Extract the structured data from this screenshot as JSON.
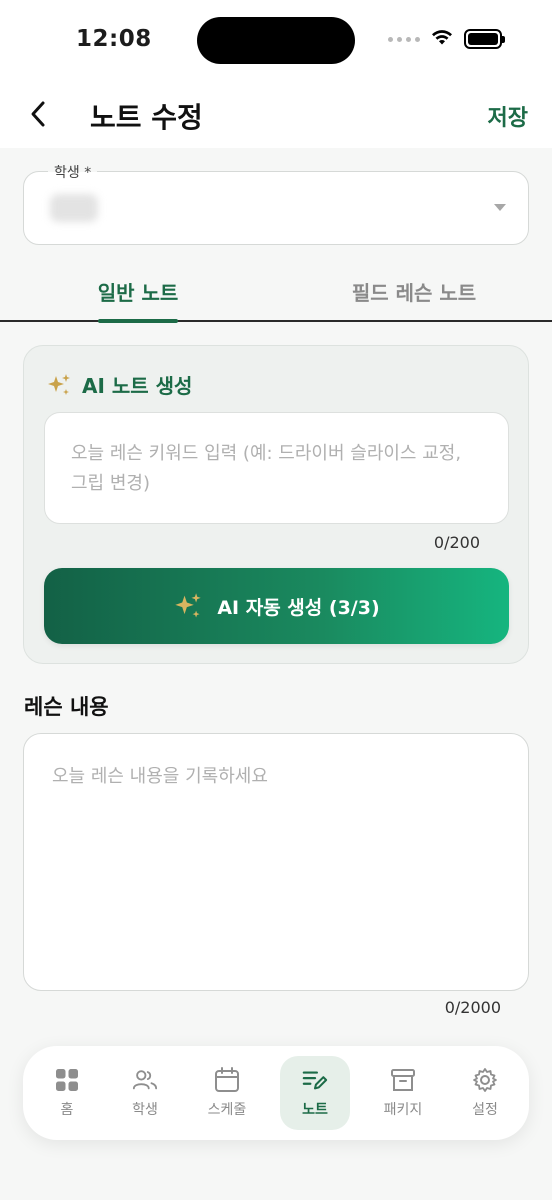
{
  "status_bar": {
    "time": "12:08"
  },
  "header": {
    "title": "노트 수정",
    "save_label": "저장",
    "back_icon": "chevron-left-icon"
  },
  "student_field": {
    "label": "학생 *",
    "selected_value": ""
  },
  "tabs": [
    {
      "label": "일반 노트",
      "active": true
    },
    {
      "label": "필드 레슨 노트",
      "active": false
    }
  ],
  "ai_card": {
    "title": "AI 노트 생성",
    "keyword_placeholder": "오늘 레슨 키워드 입력 (예: 드라이버 슬라이스 교정, 그립 변경)",
    "keyword_value": "",
    "keyword_counter": "0/200",
    "generate_button_label": "AI 자동 생성 (3/3)"
  },
  "lesson": {
    "section_title": "레슨 내용",
    "placeholder": "오늘 레슨 내용을 기록하세요",
    "value": "",
    "counter": "0/2000"
  },
  "bottom_nav": [
    {
      "label": "홈",
      "icon": "grid-icon",
      "active": false
    },
    {
      "label": "학생",
      "icon": "people-icon",
      "active": false
    },
    {
      "label": "스케줄",
      "icon": "calendar-icon",
      "active": false
    },
    {
      "label": "노트",
      "icon": "note-edit-icon",
      "active": true
    },
    {
      "label": "패키지",
      "icon": "archive-box-icon",
      "active": false
    },
    {
      "label": "설정",
      "icon": "gear-icon",
      "active": false
    }
  ],
  "colors": {
    "accent": "#1c6b47",
    "sparkle": "#c9a24a",
    "button_gradient_start": "#136146",
    "button_gradient_end": "#16b57f"
  }
}
